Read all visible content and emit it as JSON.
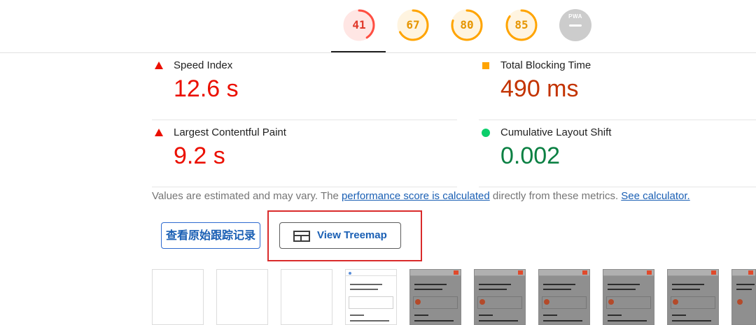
{
  "scores": [
    {
      "value": "41",
      "fraction": 0.41,
      "color": "#ff4e42",
      "bg": "#ffe6e4",
      "active": true
    },
    {
      "value": "67",
      "fraction": 0.67,
      "color": "#ffa400",
      "bg": "#fff4e0",
      "active": false
    },
    {
      "value": "80",
      "fraction": 0.8,
      "color": "#ffa400",
      "bg": "#fff4e0",
      "active": false
    },
    {
      "value": "85",
      "fraction": 0.85,
      "color": "#ffa400",
      "bg": "#fff4e0",
      "active": false
    }
  ],
  "pwa": {
    "label": "PWA"
  },
  "metrics": {
    "speed_index": {
      "label": "Speed Index",
      "value": "12.6 s",
      "status": "fail",
      "color": "#eb0f00"
    },
    "total_blocking_time": {
      "label": "Total Blocking Time",
      "value": "490 ms",
      "status": "average",
      "color": "#c33300"
    },
    "largest_contentful_paint": {
      "label": "Largest Contentful Paint",
      "value": "9.2 s",
      "status": "fail",
      "color": "#eb0f00"
    },
    "cumulative_layout_shift": {
      "label": "Cumulative Layout Shift",
      "value": "0.002",
      "status": "pass",
      "color": "#0b8043"
    }
  },
  "note": {
    "prefix": "Values are estimated and may vary. The ",
    "link1": "performance score is calculated",
    "middle": " directly from these metrics. ",
    "link2": "See calculator."
  },
  "buttons": {
    "trace": "查看原始跟踪记录",
    "treemap": "View Treemap"
  },
  "icons": {
    "fail": "triangle-icon",
    "average": "square-icon",
    "pass": "circle-icon",
    "treemap": "treemap-icon"
  }
}
